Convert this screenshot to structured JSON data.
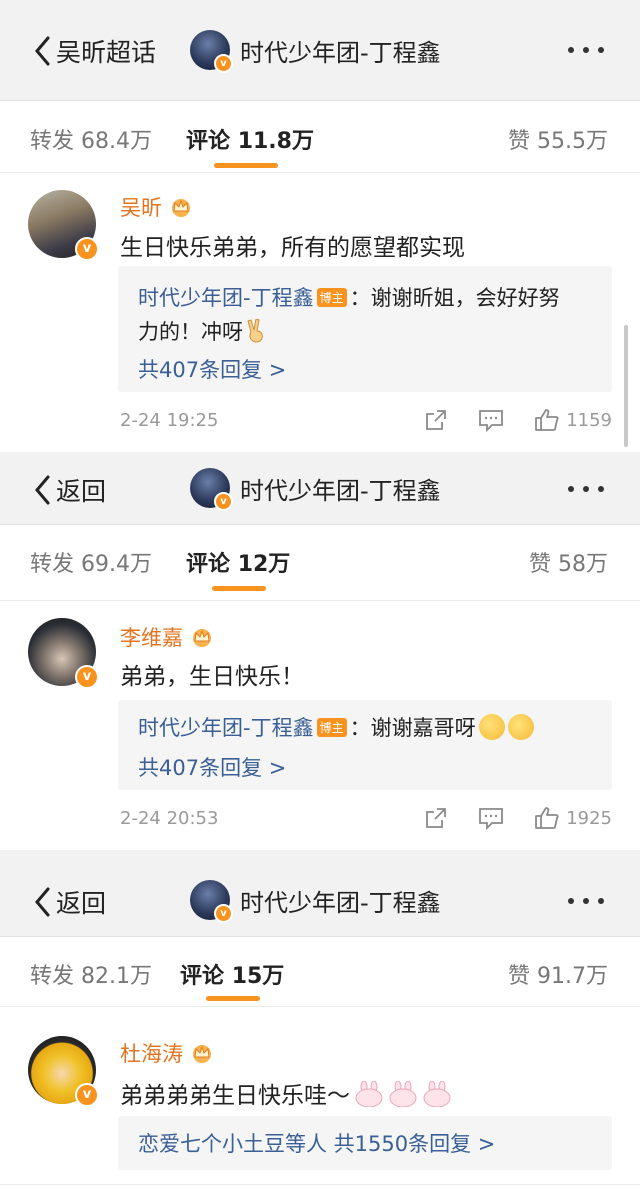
{
  "colors": {
    "accent": "#f7931e",
    "username": "#e3741f",
    "reply_name": "#3a5f95"
  },
  "panels": [
    {
      "back_label": "吴昕超话",
      "title": "时代少年团-丁程鑫",
      "tabs": {
        "forward": "转发 68.4万",
        "comment_label": "评论",
        "comment_count": "11.8万",
        "like": "赞 55.5万"
      },
      "comment": {
        "username": "吴昕",
        "text": "生日快乐弟弟，所有的愿望都实现",
        "reply_author": "时代少年团-丁程鑫",
        "host_badge": "博主",
        "reply_text_1": "：谢谢昕姐，会好好努",
        "reply_text_2": "力的！冲呀",
        "reply_text_2_icon": "victory-hand-emoji",
        "reply_count": "共407条回复 >",
        "time": "2-24 19:25",
        "likes": "1159"
      }
    },
    {
      "back_label": "返回",
      "title": "时代少年团-丁程鑫",
      "tabs": {
        "forward": "转发 69.4万",
        "comment_label": "评论",
        "comment_count": "12万",
        "like": "赞 58万"
      },
      "comment": {
        "username": "李维嘉",
        "text": "弟弟，生日快乐！",
        "reply_author": "时代少年团-丁程鑫",
        "host_badge": "博主",
        "reply_text_1": "：谢谢嘉哥呀",
        "reply_text_1_icons": [
          "party-face-emoji",
          "party-face-emoji"
        ],
        "reply_count": "共407条回复 >",
        "time": "2-24 20:53",
        "likes": "1925"
      }
    },
    {
      "back_label": "返回",
      "title": "时代少年团-丁程鑫",
      "tabs": {
        "forward": "转发 82.1万",
        "comment_label": "评论",
        "comment_count": "15万",
        "like": "赞 91.7万"
      },
      "comment": {
        "username": "杜海涛",
        "text": "弟弟弟弟生日快乐哇～",
        "text_icons": [
          "bunny-emoji",
          "bunny-emoji",
          "bunny-emoji"
        ],
        "reply_summary": "恋爱七个小土豆等人 共1550条回复 >"
      }
    }
  ],
  "icons": [
    "back-chevron-icon",
    "more-dots-icon",
    "share-icon",
    "comment-icon",
    "thumbs-up-icon",
    "crown-icon",
    "verified-badge-icon"
  ]
}
